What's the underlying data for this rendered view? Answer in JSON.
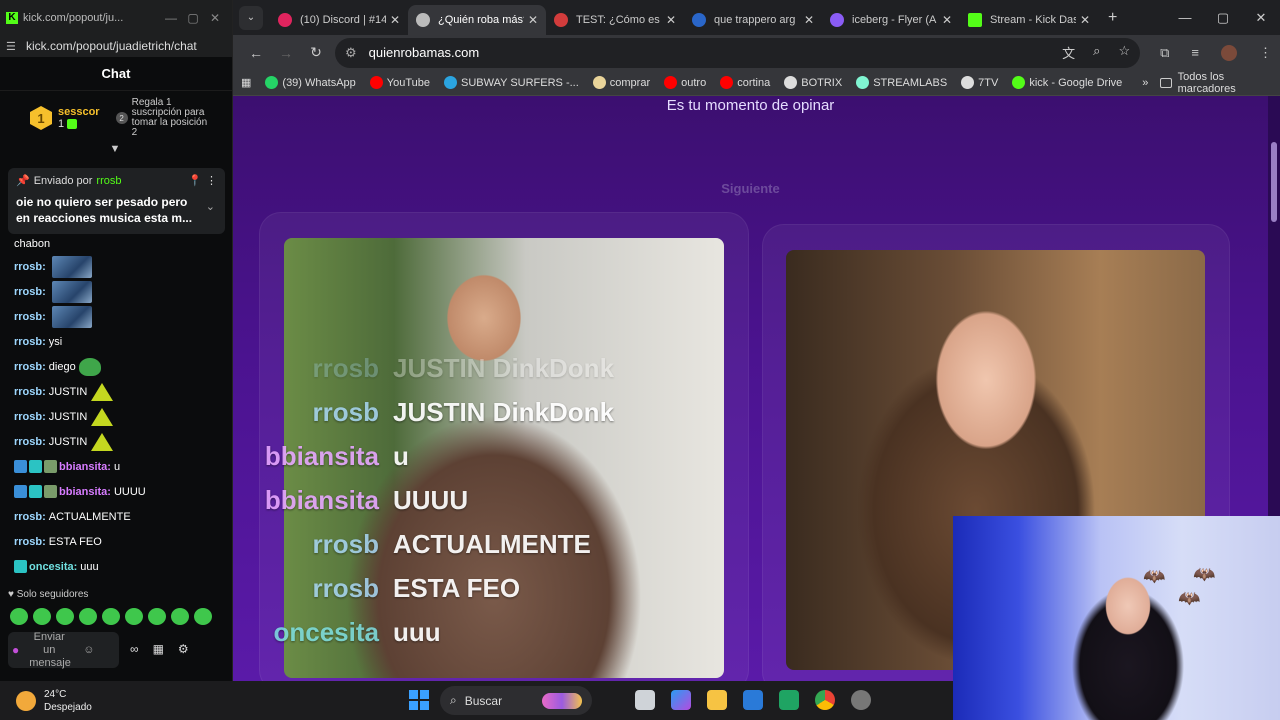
{
  "kick": {
    "window_title": "kick.com/popout/ju...",
    "url": "kick.com/popout/juadietrich/chat",
    "chat_header": "Chat",
    "leaderboard": {
      "rank": "1",
      "user": "sesscor",
      "count": "1",
      "slot": "2",
      "prompt": "Regala 1 suscripción para tomar la posición 2"
    },
    "pinned": {
      "label": "Enviado por",
      "by": "rrosb",
      "message": "oie no quiero ser pesado pero en reacciones musica esta m..."
    },
    "messages": [
      {
        "user": "",
        "text": "chabon"
      },
      {
        "user": "rrosb:",
        "text": ""
      },
      {
        "user": "rrosb:",
        "text": ""
      },
      {
        "user": "rrosb:",
        "text": ""
      },
      {
        "user": "rrosb:",
        "text": "ysi"
      },
      {
        "user": "rrosb:",
        "text": "diego"
      },
      {
        "user": "rrosb:",
        "text": "JUSTIN"
      },
      {
        "user": "rrosb:",
        "text": "JUSTIN"
      },
      {
        "user": "rrosb:",
        "text": "JUSTIN"
      },
      {
        "user": "bbiansita:",
        "text": "u"
      },
      {
        "user": "bbiansita:",
        "text": "UUUU"
      },
      {
        "user": "rrosb:",
        "text": "ACTUALMENTE"
      },
      {
        "user": "rrosb:",
        "text": "ESTA FEO"
      },
      {
        "user": "oncesita:",
        "text": "uuu"
      }
    ],
    "followers_only": "Solo seguidores",
    "input_placeholder": "Enviar un mensaje"
  },
  "browser": {
    "tabs": [
      {
        "title": "(10) Discord | #14",
        "color": "#e0245e"
      },
      {
        "title": "¿Quién roba más?",
        "color": "#ffffff"
      },
      {
        "title": "TEST: ¿Cómo es tu",
        "color": "#d23c3c"
      },
      {
        "title": "que trappero arg",
        "color": "#2a66c9"
      },
      {
        "title": "iceberg - Flyer (A",
        "color": "#8a5cf5"
      },
      {
        "title": "Stream - Kick Das",
        "color": "#53fc18"
      }
    ],
    "url": "quienrobamas.com",
    "bookmarks": [
      {
        "label": "(39) WhatsApp",
        "color": "#25d366"
      },
      {
        "label": "YouTube",
        "color": "#ff0000"
      },
      {
        "label": "SUBWAY SURFERS -...",
        "color": "#2ba4e0"
      },
      {
        "label": "comprar",
        "color": "#e9d49a"
      },
      {
        "label": "outro",
        "color": "#ff0000"
      },
      {
        "label": "cortina",
        "color": "#ff0000"
      },
      {
        "label": "BOTRIX",
        "color": "#dddddd"
      },
      {
        "label": "STREAMLABS",
        "color": "#80f5d2"
      },
      {
        "label": "7TV",
        "color": "#dddddd"
      },
      {
        "label": "kick - Google Drive",
        "color": "#53fc18"
      }
    ],
    "all_bookmarks": "Todos los marcadores"
  },
  "page": {
    "headline": "Es tu momento de opinar",
    "next_label": "Siguiente",
    "overlay": [
      {
        "user": "rrosb",
        "text": "JUSTIN DinkDonk",
        "color": "blue"
      },
      {
        "user": "rrosb",
        "text": "JUSTIN DinkDonk",
        "color": "blue"
      },
      {
        "user": "bbiansita",
        "text": "u",
        "color": "pink"
      },
      {
        "user": "bbiansita",
        "text": "UUUU",
        "color": "pink"
      },
      {
        "user": "rrosb",
        "text": "ACTUALMENTE",
        "color": "blue"
      },
      {
        "user": "rrosb",
        "text": "ESTA FEO",
        "color": "blue"
      },
      {
        "user": "oncesita",
        "text": "uuu",
        "color": "teal"
      }
    ]
  },
  "taskbar": {
    "temp": "24°C",
    "condition": "Despejado",
    "search_label": "Buscar"
  }
}
